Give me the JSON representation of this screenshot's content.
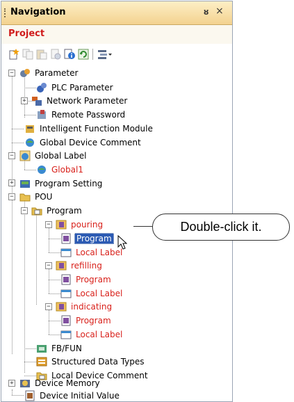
{
  "navigation": {
    "title": "Navigation",
    "pin_glyph": "ȣ",
    "close_glyph": "×",
    "project_label": "Project",
    "toolbar": [
      "new-item-icon",
      "copy-icon",
      "paste-icon",
      "properties-icon",
      "info-icon",
      "refresh-icon",
      "column-settings-icon"
    ]
  },
  "tree": {
    "parameter": "Parameter",
    "plc_parameter": "PLC Parameter",
    "network_parameter": "Network Parameter",
    "remote_password": "Remote Password",
    "intelligent_function_module": "Intelligent Function Module",
    "global_device_comment": "Global Device Comment",
    "global_label": "Global Label",
    "global1": "Global1",
    "program_setting": "Program Setting",
    "pou": "POU",
    "program": "Program",
    "pouring": "pouring",
    "pouring_program": "Program",
    "pouring_local_label": "Local Label",
    "refilling": "refilling",
    "refilling_program": "Program",
    "refilling_local_label": "Local Label",
    "indicating": "indicating",
    "indicating_program": "Program",
    "indicating_local_label": "Local Label",
    "fb_fun": "FB/FUN",
    "structured_data_types": "Structured Data Types",
    "local_device_comment": "Local Device Comment",
    "device_memory": "Device Memory",
    "device_initial_value": "Device Initial Value"
  },
  "callout": {
    "text": "Double-click it."
  },
  "colors": {
    "title_gradient_top": "#fdefc6",
    "title_gradient_bottom": "#f3d28f",
    "project_red": "#d01c1c",
    "label_red": "#d8201a",
    "selection_blue": "#2b5ab3"
  }
}
